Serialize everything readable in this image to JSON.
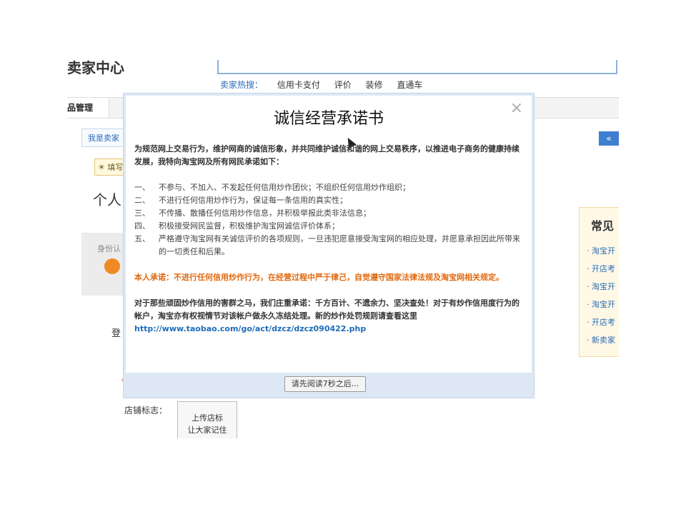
{
  "background": {
    "header_title": "卖家中心",
    "hot_label": "卖家热搜：",
    "hot_links": [
      "信用卡支付",
      "评价",
      "装修",
      "直通车"
    ],
    "nav_tab": "品管理",
    "breadcrumb": "我是卖家",
    "collapse_icon": "«",
    "tip": "填写",
    "personal_heading": "个人",
    "identity_label": "身份认",
    "login_label": "登",
    "required_mark": "*",
    "shop_logo_label": "店铺标志：",
    "upload_line1": "上传店标",
    "upload_line2": "让大家记住",
    "side_title": "常见",
    "side_links": [
      "淘宝开",
      "开店考",
      "淘宝开",
      "淘宝开",
      "开店考",
      "新卖家"
    ]
  },
  "modal": {
    "title": "诚信经营承诺书",
    "close_label": "×",
    "intro": "为规范网上交易行为，维护网商的诚信形象，并共同维护诚信和谐的网上交易秩序，以推进电子商务的健康持续发展，我特向淘宝网及所有网民承诺如下：",
    "rules": [
      {
        "num": "一、",
        "text": "不参与、不加入、不发起任何信用炒作团伙；不组织任何信用炒作组织；"
      },
      {
        "num": "二、",
        "text": "不进行任何信用炒作行为，保证每一条信用的真实性；"
      },
      {
        "num": "三、",
        "text": "不传播、散播任何信用炒作信息，并积极举报此类非法信息；"
      },
      {
        "num": "四、",
        "text": "积极接受网民监督，积极维护淘宝网诚信评价体系；"
      },
      {
        "num": "五、",
        "text": "严格遵守淘宝网有关诚信评价的各项规则，一旦违犯愿意接受淘宝网的相应处理，并愿意承担因此所带来的一切责任和后果。"
      }
    ],
    "pledge": "本人承诺：不进行任何信用炒作行为，在经营过程中严于律己，自觉遵守国家法律法规及淘宝网相关规定。",
    "warning": "对于那些顽固炒作信用的害群之马，我们庄重承诺：千方百计、不遗余力、坚决查处！对于有炒作信用度行为的帐户，淘宝亦有权视情节对该帐户做永久冻结处理。新的炒作处罚规则请查看这里",
    "link": "http://www.taobao.com/go/act/dzcz/dzcz090422.php",
    "button": "请先阅读7秒之后..."
  }
}
